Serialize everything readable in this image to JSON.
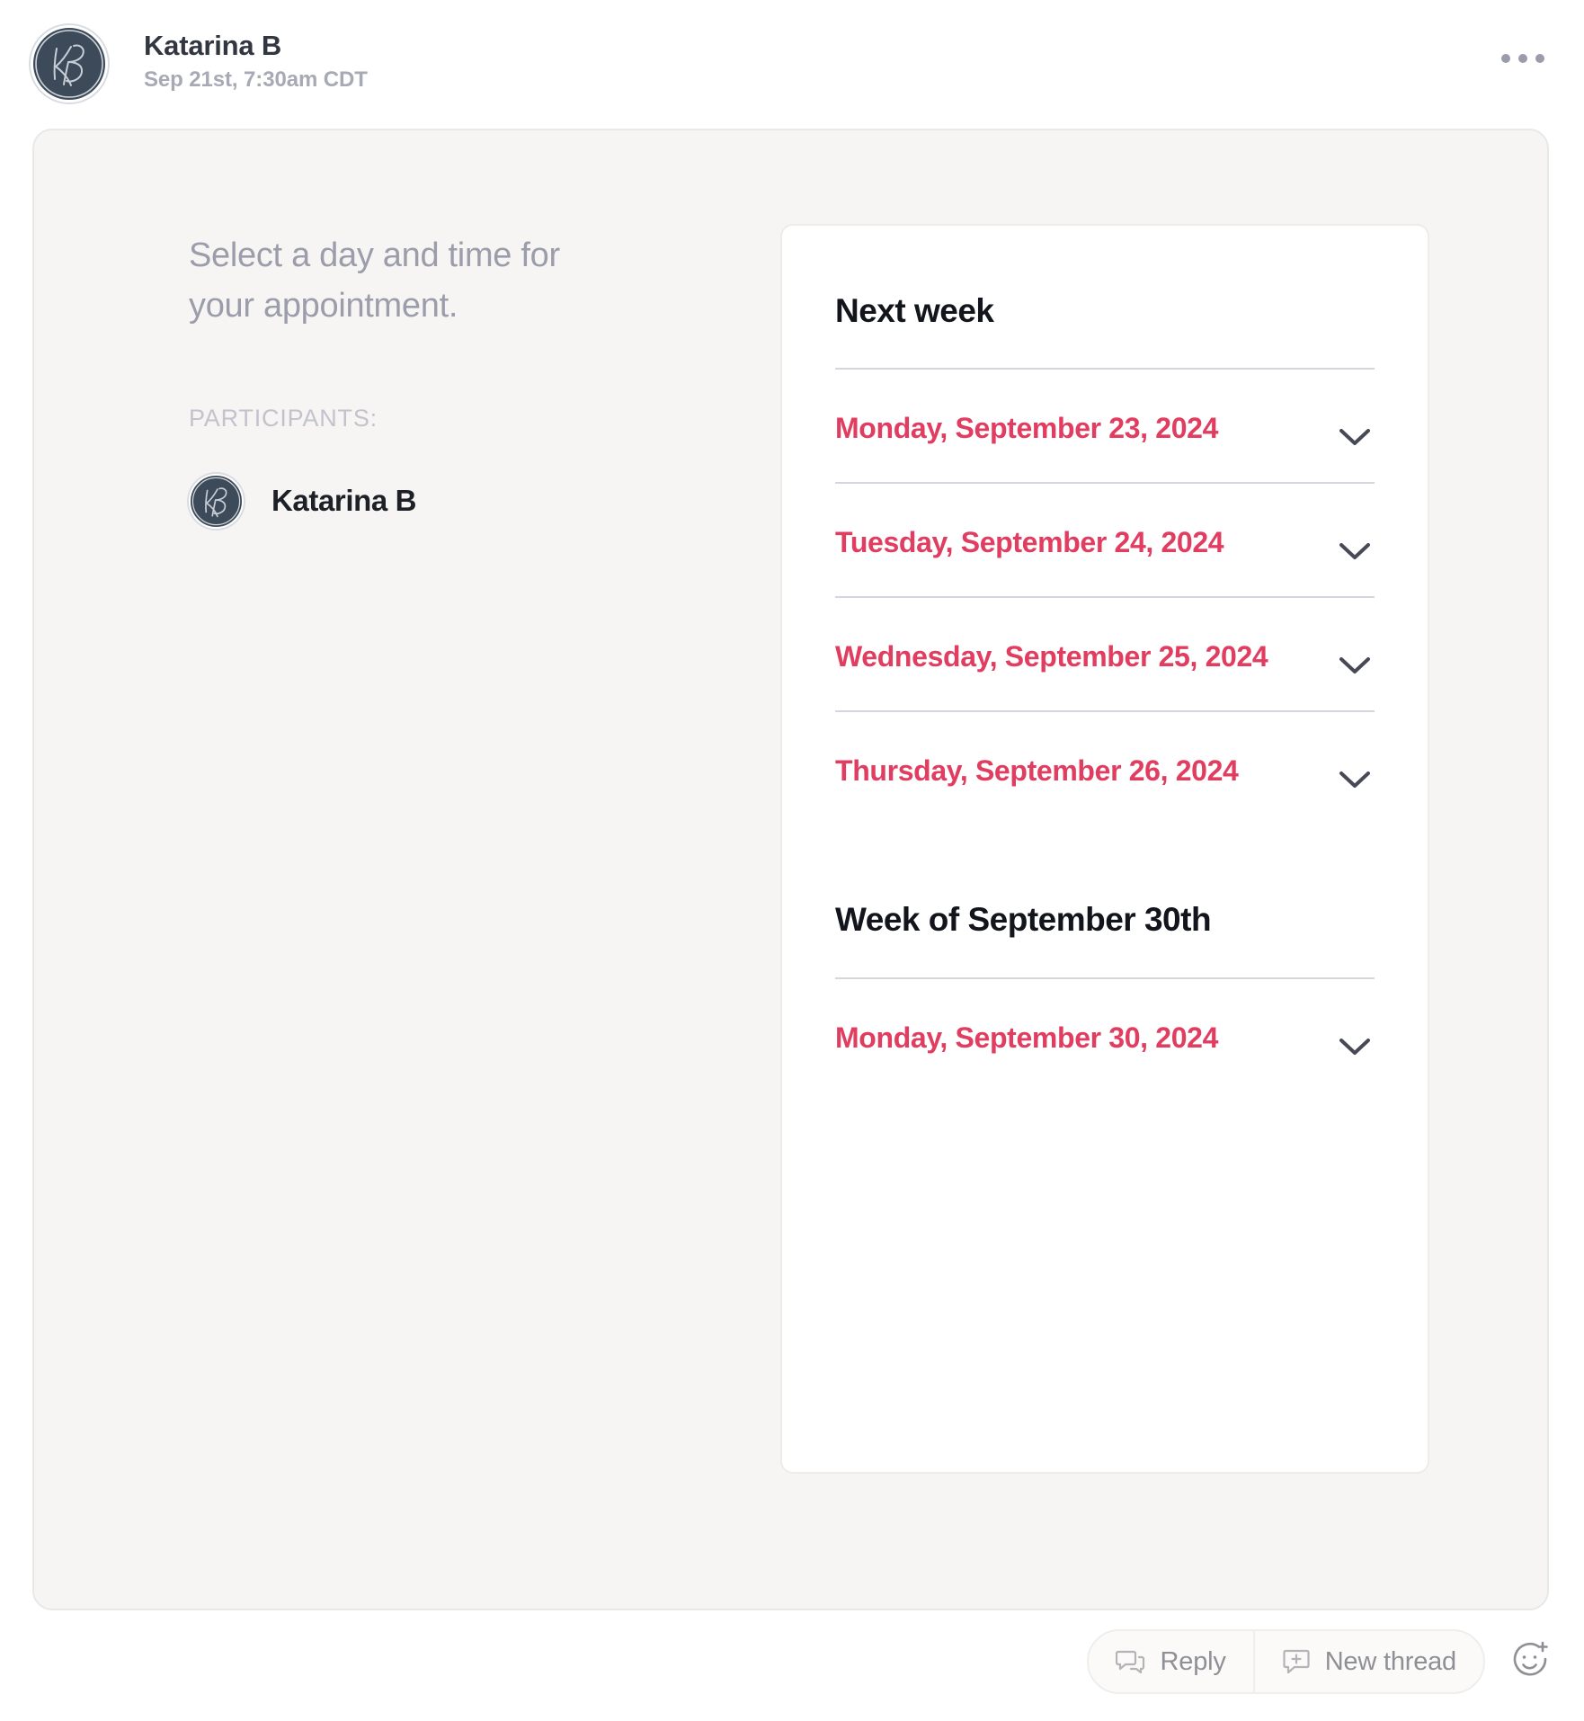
{
  "message": {
    "sender_name": "Katarina B",
    "timestamp": "Sep 21st, 7:30am CDT",
    "avatar_initials": "KB",
    "overflow_icon": "ellipsis-horizontal-icon"
  },
  "attachment": {
    "prompt_title": "Select a day and time for your appointment.",
    "participants_label": "PARTICIPANTS:",
    "participants": [
      {
        "name": "Katarina B",
        "initials": "KB"
      }
    ],
    "scheduler": {
      "groups": [
        {
          "heading": "Next week",
          "days": [
            {
              "label": "Monday, September 23, 2024",
              "expand_icon": "chevron-down-icon"
            },
            {
              "label": "Tuesday, September 24, 2024",
              "expand_icon": "chevron-down-icon"
            },
            {
              "label": "Wednesday, September 25, 2024",
              "expand_icon": "chevron-down-icon"
            },
            {
              "label": "Thursday, September 26, 2024",
              "expand_icon": "chevron-down-icon"
            }
          ]
        },
        {
          "heading": "Week of September 30th",
          "days": [
            {
              "label": "Monday, September 30, 2024",
              "expand_icon": "chevron-down-icon"
            }
          ]
        }
      ]
    }
  },
  "action_bar": {
    "reply_label": "Reply",
    "reply_icon": "chat-bubbles-icon",
    "new_thread_label": "New thread",
    "new_thread_icon": "bubble-plus-icon",
    "reaction_icon": "emoji-plus-icon"
  },
  "colors": {
    "accent_pink": "#e13d60",
    "avatar_navy": "#3c4a59",
    "heading_dark": "#12151c",
    "muted_gray": "#9b9daa",
    "divider": "#d5d5dd",
    "card_bg": "#f6f5f3"
  }
}
